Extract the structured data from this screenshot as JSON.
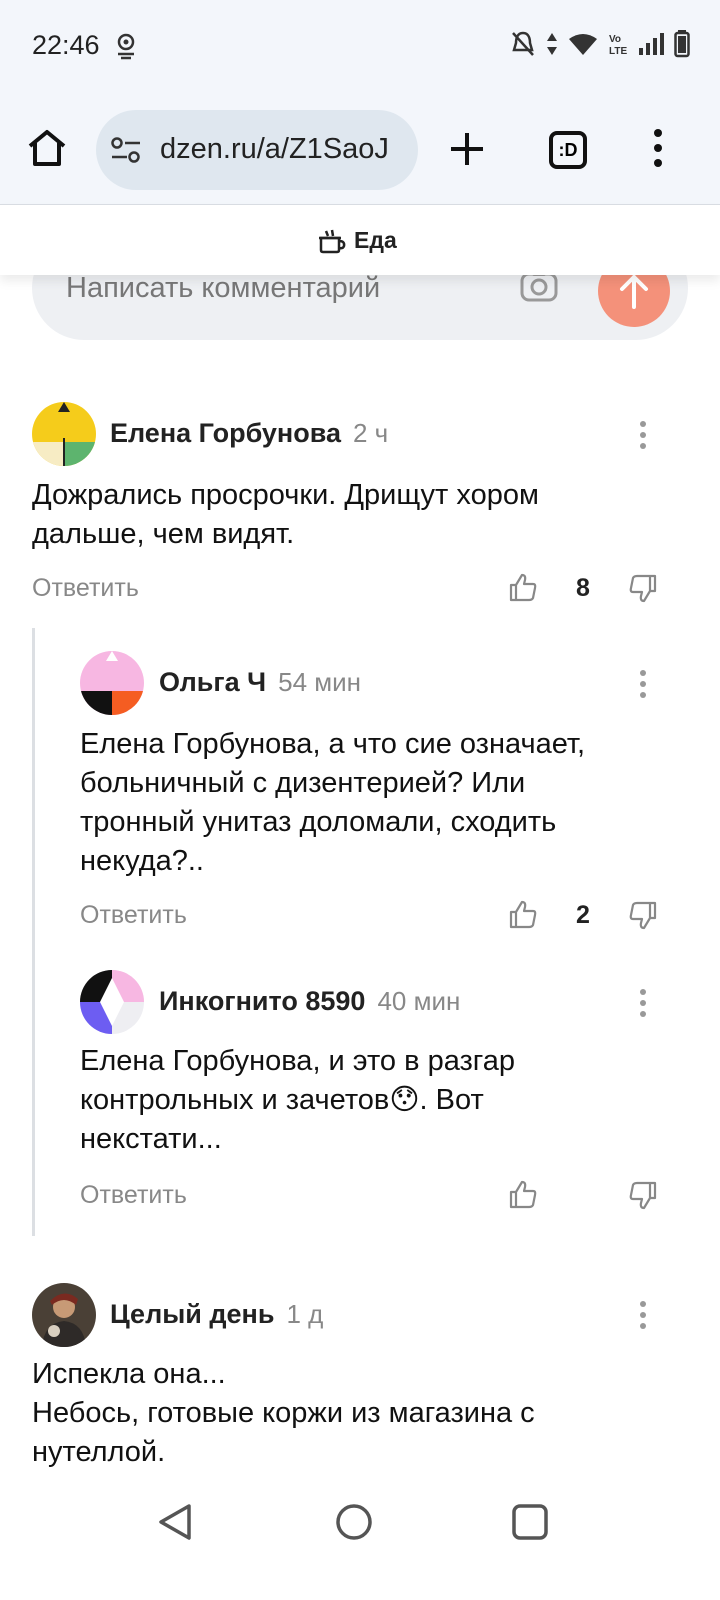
{
  "status_bar": {
    "time": "22:46"
  },
  "browser": {
    "url": "dzen.ru/a/Z1SaoJ",
    "tabs_label": ":D"
  },
  "section": {
    "title": "Еда"
  },
  "compose": {
    "placeholder": "Написать комментарий"
  },
  "comments": [
    {
      "author": "Елена Горбунова",
      "age": "2 ч",
      "lines": [
        "Дожрались просрочки. Дрищут хором",
        "дальше, чем видят."
      ],
      "reply": "Ответить",
      "likes": "8"
    },
    {
      "author": "Ольга Ч",
      "age": "54 мин",
      "lines": [
        "Елена Горбунова, а что сие означает,",
        "больничный с дизентерией? Или",
        "тронный унитаз доломали, сходить",
        "некуда?.."
      ],
      "reply": "Ответить",
      "likes": "2"
    },
    {
      "author": "Инкогнито 8590",
      "age": "40 мин",
      "lines": [
        "Елена Горбунова, и это в разгар",
        "контрольных и зачетов😯. Вот",
        "некстати..."
      ],
      "reply": "Ответить",
      "likes": ""
    },
    {
      "author": "Целый день",
      "age": "1 д",
      "lines": [
        "Испекла она...",
        "Небось, готовые коржи из магазина с",
        "нутеллой."
      ],
      "reply": "",
      "likes": ""
    }
  ]
}
